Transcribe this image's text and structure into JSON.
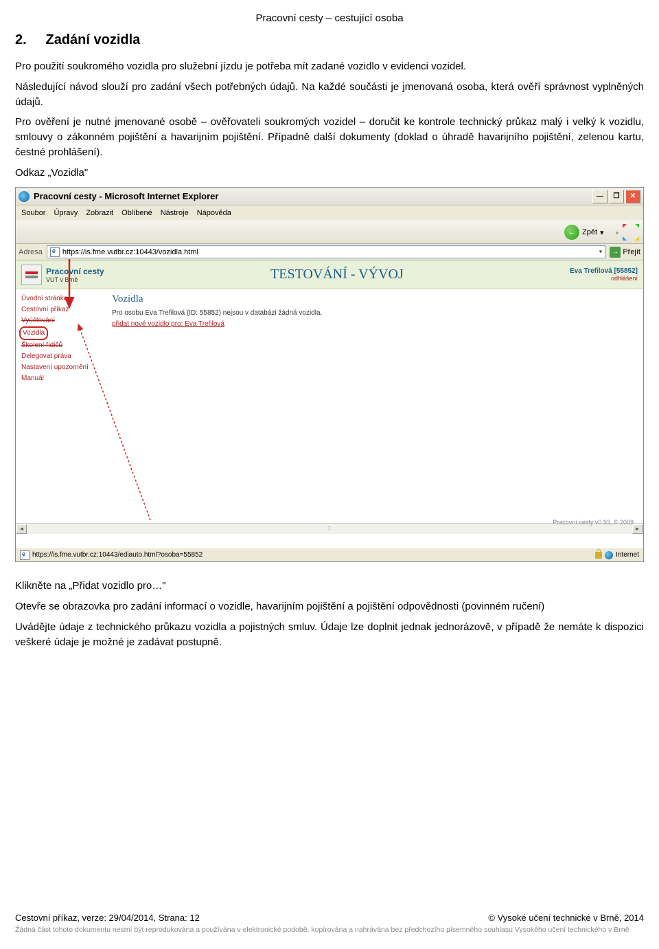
{
  "header": {
    "breadcrumb": "Pracovní cesty – cestující osoba"
  },
  "section": {
    "number": "2.",
    "title": "Zadání vozidla"
  },
  "para": {
    "p1": "Pro použití soukromého vozidla pro služební jízdu je potřeba mít zadané vozidlo v evidenci vozidel.",
    "p2": "Následující návod slouží pro zadání všech potřebných údajů. Na každé součásti je jmenovaná osoba, která ověří správnost vyplněných údajů.",
    "p3": "Pro ověření je nutné jmenované osobě – ověřovateli soukromých vozidel – doručit ke kontrole technický průkaz malý i velký k vozidlu, smlouvy o zákonném pojištění a havarijním pojištění. Případně další dokumenty (doklad o úhradě havarijního pojištění, zelenou kartu, čestné prohlášení).",
    "p4": "Odkaz „Vozidla\""
  },
  "browser": {
    "title": "Pracovní cesty - Microsoft Internet Explorer",
    "menus": [
      "Soubor",
      "Úpravy",
      "Zobrazit",
      "Oblíbené",
      "Nástroje",
      "Nápověda"
    ],
    "back_label": "Zpět",
    "addr_label": "Adresa",
    "url": "https://is.fme.vutbr.cz:10443/vozidla.html",
    "go_label": "Přejít",
    "status_url": "https://is.fme.vutbr.cz:10443/ediauto.html?osoba=55852",
    "zone": "Internet"
  },
  "app": {
    "title1": "Pracovní cesty",
    "title2": "VUT v Brně",
    "center": "TESTOVÁNÍ - VÝVOJ",
    "user": "Eva Trefilová [55852]",
    "logout": "odhlášení",
    "sidebar": {
      "s0": "Úvodní stránka",
      "s1": "Cestovní příkaz",
      "s2": "Vyúčtování",
      "s3": "Vozidla",
      "s4": "Školení řidičů",
      "s5": "Delegovat práva",
      "s6": "Nastavení upozornění",
      "s7": "Manuál"
    },
    "main": {
      "heading": "Vozidla",
      "info": "Pro osobu Eva Trefilová (ID: 55852) nejsou v databázi žádná vozidla.",
      "addlink": "přidat nové vozidlo pro: Eva Trefilová"
    },
    "footer_text": "Pracovní cesty v0.93, © 2009"
  },
  "after": {
    "p1": "Klikněte na „Přidat vozidlo pro…\"",
    "p2": "Otevře se obrazovka pro zadání informací o vozidle, havarijním pojištění a pojištění odpovědnosti (povinném ručení)",
    "p3": "Uvádějte údaje z technického průkazu vozidla a pojistných smluv. Údaje lze doplnit jednak jednorázově, v případě že nemáte k dispozici veškeré údaje je možné je zadávat postupně."
  },
  "footer": {
    "left": "Cestovní příkaz, verze: 29/04/2014, Strana: 12",
    "right": "© Vysoké učení technické v Brně, 2014",
    "disclaimer": "Žádná část tohoto dokumentu nesmí být reprodukována a používána v elektronické podobě, kopírována a nahrávána bez předchozího písemného souhlasu Vysokého učení technického v Brně"
  }
}
